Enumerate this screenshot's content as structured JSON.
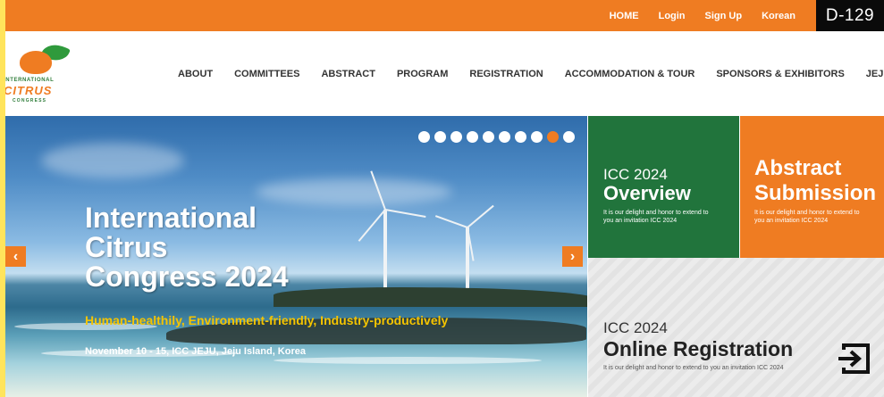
{
  "topbar": {
    "links": [
      "HOME",
      "Login",
      "Sign Up",
      "Korean"
    ],
    "dday": "D-129"
  },
  "logo": {
    "line1": "INTERNATIONAL",
    "line2": "CITRUS",
    "line3": "CONGRESS"
  },
  "nav": {
    "items": [
      "ABOUT",
      "COMMITTEES",
      "ABSTRACT",
      "PROGRAM",
      "REGISTRATION",
      "ACCOMMODATION & TOUR",
      "SPONSORS & EXHIBITORS",
      "JEJU CITRUS EXP"
    ]
  },
  "hero": {
    "title_lines": [
      "International",
      "Citrus",
      "Congress 2024"
    ],
    "subtitle": "Human-healthily, Environment-friendly, Industry-productively",
    "date_place": "November 10 - 15, ICC JEJU, Jeju Island, Korea",
    "slide_count": 10,
    "active_slide": 9,
    "prev_icon": "chevron-left-icon",
    "next_icon": "chevron-right-icon"
  },
  "tiles": {
    "overview": {
      "year": "ICC 2024",
      "title": "Overview",
      "desc": "It is our delight and honor to extend to you an invitation ICC 2024"
    },
    "abstract": {
      "title_line1": "Abstract",
      "title_line2": "Submission",
      "desc": "It is our delight and honor to extend to you an invitation ICC 2024"
    },
    "registration": {
      "year": "ICC 2024",
      "title": "Online Registration",
      "desc": "It is our delight and honor to extend to you an invitation ICC 2024",
      "icon": "login-arrow-icon"
    }
  },
  "colors": {
    "orange": "#ef7c22",
    "green": "#21743c",
    "black": "#0a0a0a",
    "subtitle_yellow": "#f5c400"
  }
}
